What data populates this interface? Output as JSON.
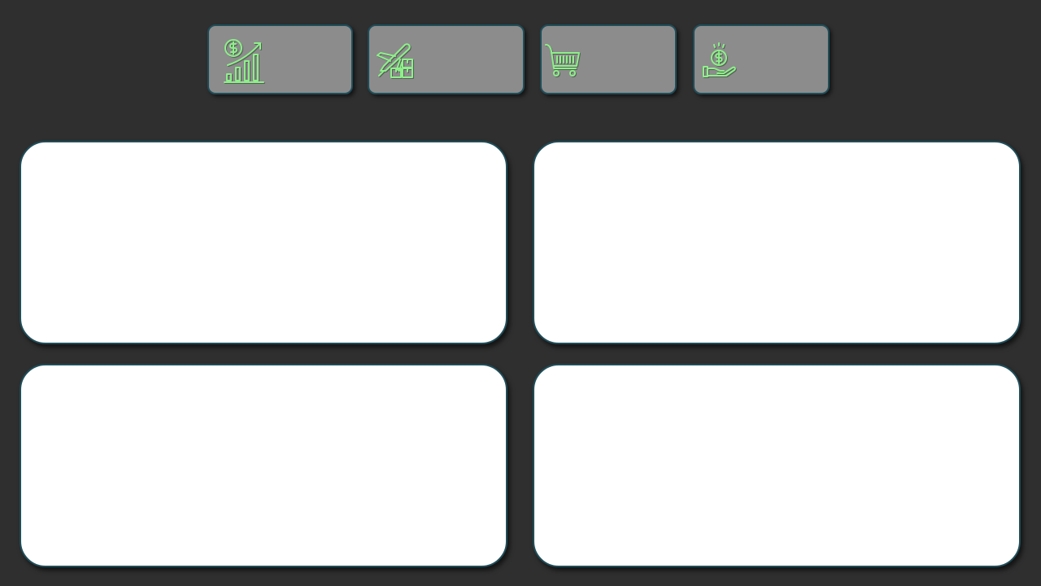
{
  "theme": {
    "background": "#2f2f2f",
    "card_fill": "#8c8c8c",
    "card_border": "#1f4e5a",
    "icon_color": "#8ef08a",
    "panel_fill": "#ffffff"
  },
  "kpi_cards": [
    {
      "icon": "revenue-growth-icon",
      "value": ""
    },
    {
      "icon": "air-cargo-shipping-icon",
      "value": ""
    },
    {
      "icon": "shopping-cart-icon",
      "value": ""
    },
    {
      "icon": "hand-coin-payment-icon",
      "value": ""
    }
  ],
  "panels": [
    {
      "title": ""
    },
    {
      "title": ""
    },
    {
      "title": ""
    },
    {
      "title": ""
    }
  ]
}
